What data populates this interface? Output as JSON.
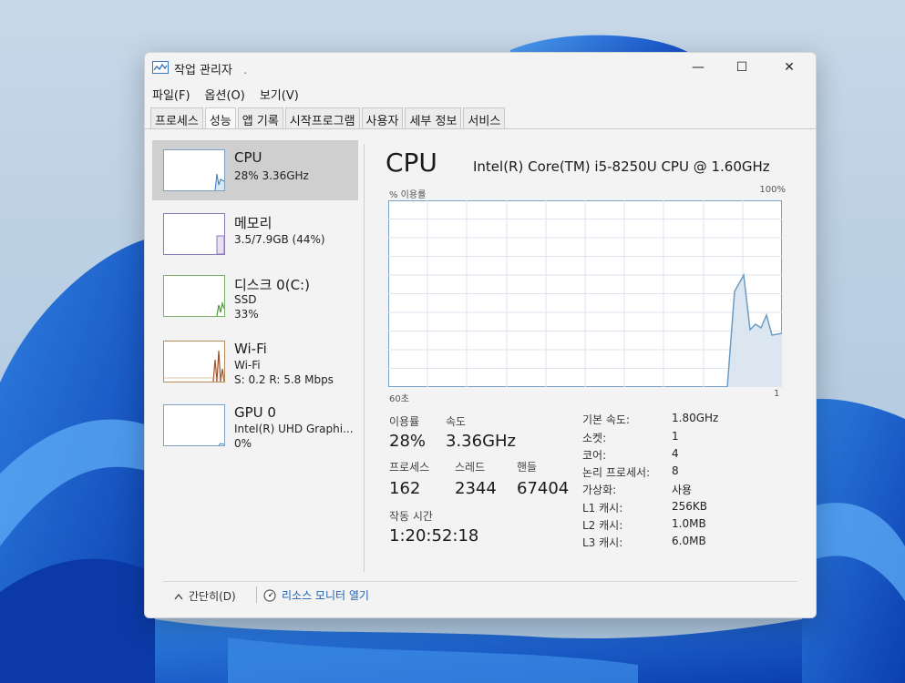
{
  "window": {
    "title": "작업 관리자",
    "title_dot": "."
  },
  "controls": {
    "minimize": "—",
    "maximize": "☐",
    "close": "✕"
  },
  "menu": [
    "파일(F)",
    "옵션(O)",
    "보기(V)"
  ],
  "tabs": [
    "프로세스",
    "성능",
    "앱 기록",
    "시작프로그램",
    "사용자",
    "세부 정보",
    "서비스"
  ],
  "active_tab": "성능",
  "sidebar": [
    {
      "title": "CPU",
      "lines": [
        "28% 3.36GHz"
      ]
    },
    {
      "title": "메모리",
      "lines": [
        "3.5/7.9GB (44%)"
      ]
    },
    {
      "title": "디스크 0(C:)",
      "lines": [
        "SSD",
        "33%"
      ]
    },
    {
      "title": "Wi-Fi",
      "lines": [
        "Wi-Fi",
        "S: 0.2 R: 5.8 Mbps"
      ]
    },
    {
      "title": "GPU 0",
      "lines": [
        "Intel(R) UHD Graphi...",
        "0%"
      ]
    }
  ],
  "main": {
    "title": "CPU",
    "model": "Intel(R) Core(TM) i5-8250U CPU @ 1.60GHz",
    "graph_label": "% 이용률",
    "graph_max": "100%",
    "axis_left": "60초",
    "axis_right": "1",
    "utilization_label": "이용률",
    "utilization": "28%",
    "speed_label": "속도",
    "speed": "3.36GHz",
    "processes_label": "프로세스",
    "processes": "162",
    "threads_label": "스레드",
    "threads": "2344",
    "handles_label": "핸들",
    "handles": "67404",
    "uptime_label": "작동 시간",
    "uptime": "1:20:52:18",
    "specs": [
      {
        "label": "기본 속도:",
        "value": "1.80GHz"
      },
      {
        "label": "소켓:",
        "value": "1"
      },
      {
        "label": "코어:",
        "value": "4"
      },
      {
        "label": "논리 프로세서:",
        "value": "8"
      },
      {
        "label": "가상화:",
        "value": "사용"
      },
      {
        "label": "L1 캐시:",
        "value": "256KB"
      },
      {
        "label": "L2 캐시:",
        "value": "1.0MB"
      },
      {
        "label": "L3 캐시:",
        "value": "6.0MB"
      }
    ]
  },
  "footer": {
    "collapse": "간단히(D)",
    "resource_monitor": "리소스 모니터 열기"
  },
  "colors": {
    "accent": "#1a5fb4",
    "graph_line": "#6d9bc3",
    "graph_fill": "#dbe6f0"
  }
}
